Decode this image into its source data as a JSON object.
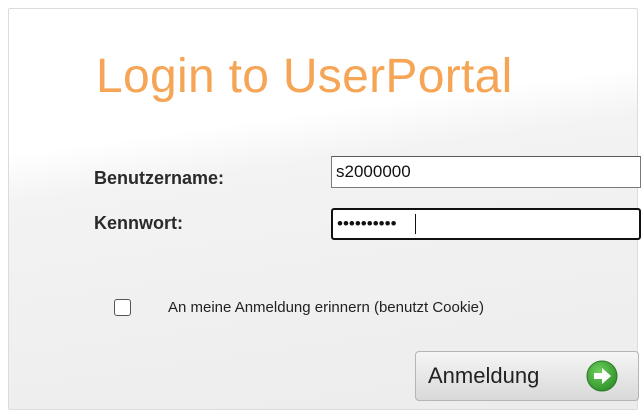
{
  "login": {
    "title": "Login to UserPortal",
    "username_label": "Benutzername:",
    "username_value": "s2000000",
    "password_label": "Kennwort:",
    "password_value": "••••••••••",
    "remember_label": "An meine Anmeldung erinnern (benutzt Cookie)",
    "remember_checked": false,
    "submit_label": "Anmeldung",
    "submit_icon": "arrow-right-circle-icon"
  },
  "colors": {
    "title": "#f5a555",
    "button_icon": "#3aa33a"
  }
}
